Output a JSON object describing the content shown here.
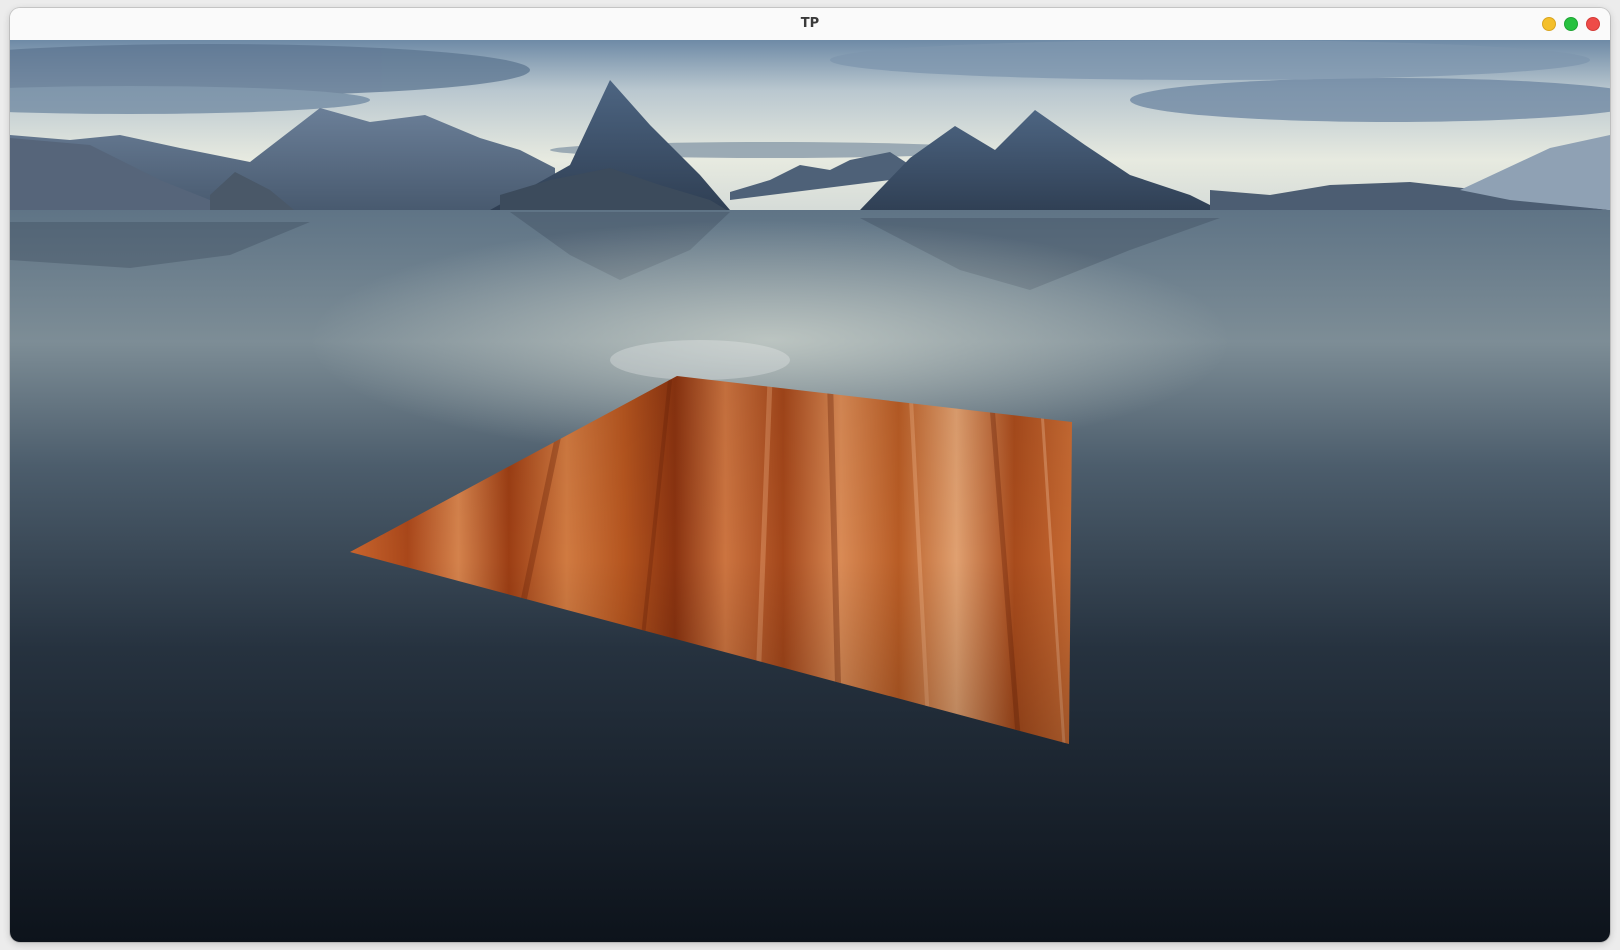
{
  "window": {
    "title": "TP",
    "controls": [
      {
        "name": "minimize-button",
        "color": "#f4bf2a"
      },
      {
        "name": "maximize-button",
        "color": "#27c13f"
      },
      {
        "name": "close-button",
        "color": "#ee4b48"
      }
    ]
  },
  "scene": {
    "description_colors": {
      "sky_top": "#5a7a99",
      "sky_horizon": "#e9ece3",
      "mountain": "#3d5470",
      "water_far": "#7a8c98",
      "water_near": "#0f1620",
      "wood_light": "#d97a42",
      "wood_dark": "#8a3512"
    }
  }
}
